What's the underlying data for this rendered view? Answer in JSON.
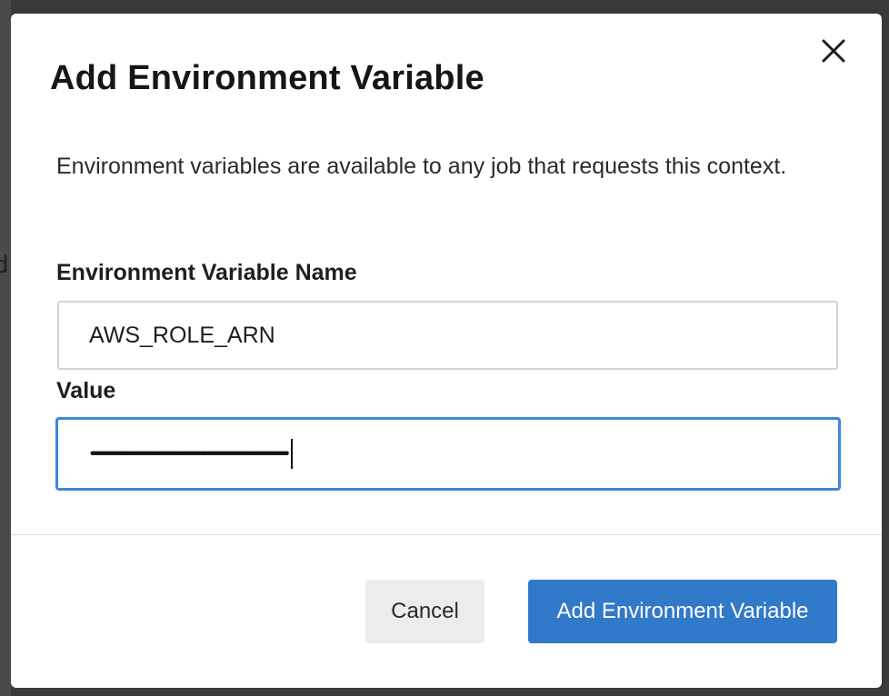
{
  "backdrop": {
    "partial_text": "d"
  },
  "dialog": {
    "title": "Add Environment Variable",
    "close_icon": "close-icon",
    "description": "Environment variables are available to any job that requests this context.",
    "name_field": {
      "label": "Environment Variable Name",
      "value": "AWS_ROLE_ARN"
    },
    "value_field": {
      "label": "Value",
      "masked_value": "••••••••••••••••••••••••••••••••••••••••••••••••••••••••••••••••••••••••••••••••••••••••••"
    },
    "buttons": {
      "cancel_label": "Cancel",
      "submit_label": "Add Environment Variable"
    }
  },
  "colors": {
    "primary": "#3179c9",
    "focus_border": "#3d86dc",
    "cancel_bg": "#ececec"
  }
}
